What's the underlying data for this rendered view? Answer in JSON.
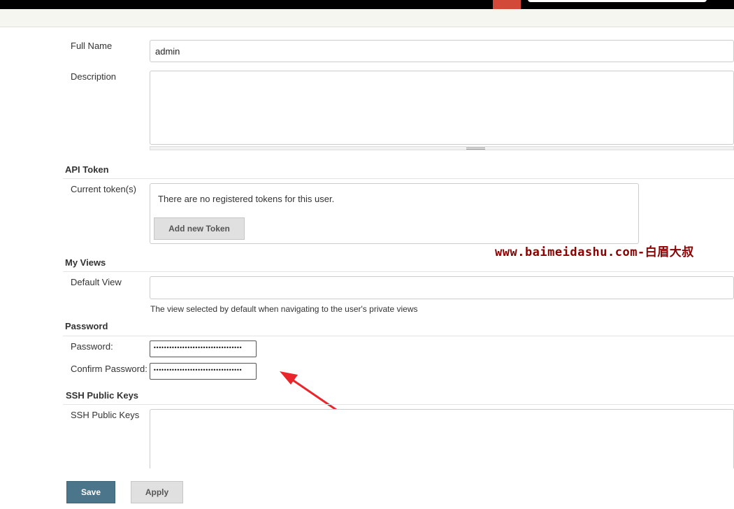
{
  "form": {
    "full_name": {
      "label": "Full Name",
      "value": "admin"
    },
    "description": {
      "label": "Description",
      "value": ""
    },
    "api_token": {
      "section_title": "API Token",
      "label": "Current token(s)",
      "empty_message": "There are no registered tokens for this user.",
      "add_button": "Add new Token"
    },
    "my_views": {
      "section_title": "My Views",
      "label": "Default View",
      "value": "",
      "help_text": "The view selected by default when navigating to the user's private views"
    },
    "password": {
      "section_title": "Password",
      "password_label": "Password:",
      "password_value": "••••••••••••••••••••••••••••••••••",
      "confirm_label": "Confirm Password:",
      "confirm_value": "••••••••••••••••••••••••••••••••••"
    },
    "ssh": {
      "section_title": "SSH Public Keys",
      "label": "SSH Public Keys",
      "value": ""
    },
    "buttons": {
      "save": "Save",
      "apply": "Apply"
    }
  },
  "watermark": "www.baimeidashu.com-白眉大叔",
  "colors": {
    "accent": "#d24939",
    "save_button": "#4b758b",
    "annotation_arrow": "#e8262b"
  }
}
